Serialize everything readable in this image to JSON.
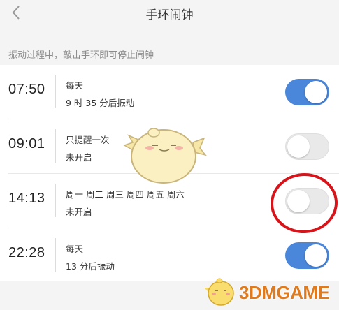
{
  "header": {
    "title": "手环闹钟",
    "back_icon": "chevron-left-icon"
  },
  "hint": "振动过程中，敲击手环即可停止闹钟",
  "alarms": [
    {
      "time": "07:50",
      "repeat": "每天",
      "status": "9 时 35 分后振动",
      "enabled": true
    },
    {
      "time": "09:01",
      "repeat": "只提醒一次",
      "status": "未开启",
      "enabled": false
    },
    {
      "time": "14:13",
      "repeat": "周一 周二 周三 周四 周五 周六",
      "status": "未开启",
      "enabled": false
    },
    {
      "time": "22:28",
      "repeat": "每天",
      "status": "13 分后振动",
      "enabled": true
    }
  ],
  "colors": {
    "toggle_on": "#4a86d9",
    "toggle_off": "#e9e9e9",
    "annotation_circle": "#d8141b",
    "watermark": "#e07a1e"
  },
  "watermark": "3DMGAME"
}
